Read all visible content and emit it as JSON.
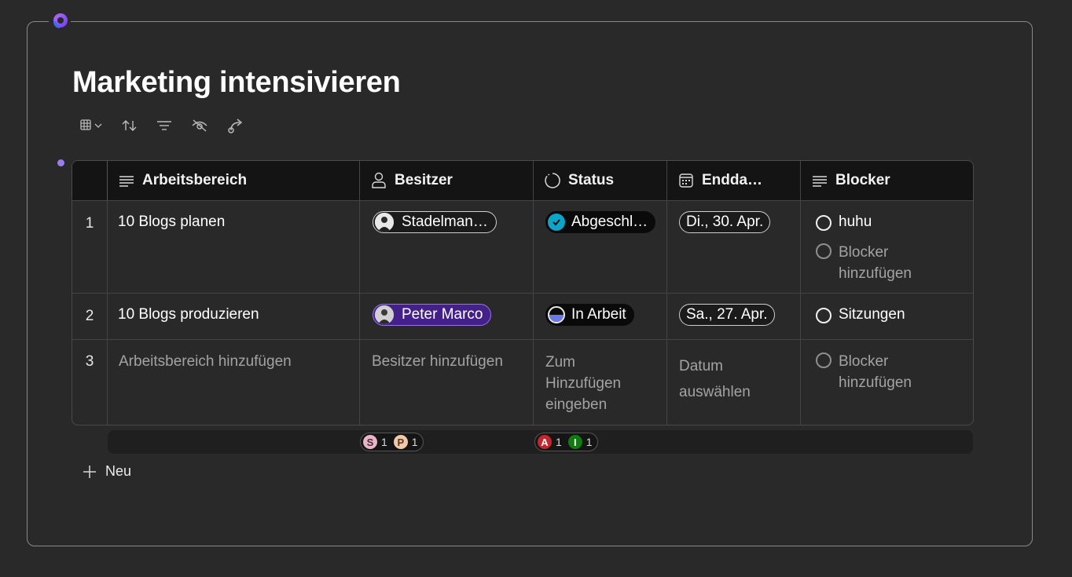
{
  "page": {
    "title": "Marketing intensivieren"
  },
  "toolbar": {
    "buttons": [
      {
        "icon": "table-view-icon"
      },
      {
        "icon": "sort-icon"
      },
      {
        "icon": "filter-icon"
      },
      {
        "icon": "hide-icon"
      },
      {
        "icon": "share-icon"
      }
    ]
  },
  "table": {
    "columns": [
      {
        "label": "Arbeitsbereich",
        "icon": "text-column-icon"
      },
      {
        "label": "Besitzer",
        "icon": "person-column-icon"
      },
      {
        "label": "Status",
        "icon": "status-column-icon"
      },
      {
        "label": "Endda…",
        "icon": "calendar-column-icon"
      },
      {
        "label": "Blocker",
        "icon": "text-column-icon"
      }
    ],
    "rows": [
      {
        "num": "1",
        "workspace": "10 Blogs planen",
        "owner": "Stadelman…",
        "status": "Abgeschl…",
        "end_date": "Di., 30. Apr.",
        "blockers": [
          "huhu"
        ],
        "blocker_add": "Blocker hinzufügen"
      },
      {
        "num": "2",
        "workspace": "10 Blogs produzieren",
        "owner": "Peter Marco",
        "status": "In Arbeit",
        "end_date": "Sa., 27. Apr.",
        "blockers": [
          "Sitzungen"
        ]
      },
      {
        "num": "3",
        "workspace_placeholder": "Arbeitsbereich hinzufügen",
        "owner_placeholder": "Besitzer hinzufügen",
        "status_placeholder": "Zum Hinzufügen eingeben",
        "date_placeholder": "Datum auswählen",
        "blocker_placeholder": "Blocker hinzufügen"
      }
    ]
  },
  "summary": {
    "owners": [
      {
        "letter": "S",
        "count": "1",
        "color": "#e8b4c8"
      },
      {
        "letter": "P",
        "count": "1",
        "color": "#f2c9a8"
      }
    ],
    "statuses": [
      {
        "letter": "A",
        "count": "1",
        "color": "#c4262e"
      },
      {
        "letter": "I",
        "count": "1",
        "color": "#107c10"
      }
    ]
  },
  "new_row": {
    "label": "Neu"
  },
  "colors": {
    "accent": "#9b7cf0",
    "done_status": "#0aa5c8",
    "in_progress_status": "#6b78e6",
    "selected_person": "#43208a"
  }
}
